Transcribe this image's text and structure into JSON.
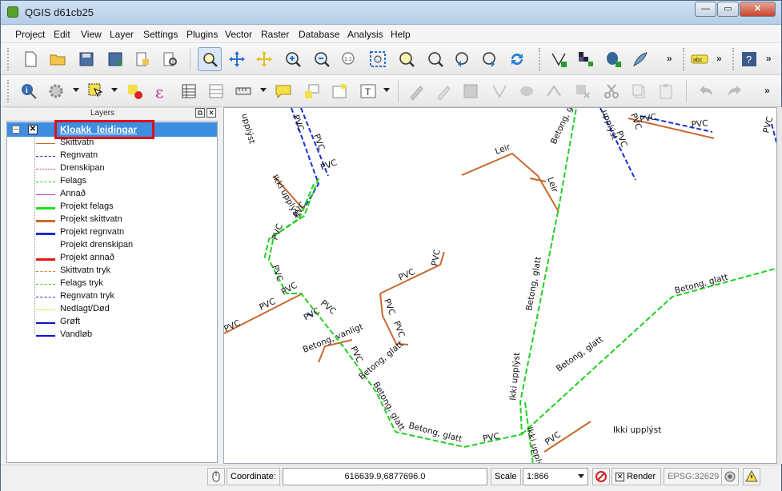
{
  "window": {
    "title": "QGIS d61cb25"
  },
  "menu": [
    "Project",
    "Edit",
    "View",
    "Layer",
    "Settings",
    "Plugins",
    "Vector",
    "Raster",
    "Database",
    "Analysis",
    "Help"
  ],
  "panel": {
    "title": "Layers"
  },
  "layer_group": {
    "name": "Kloakk_leidingar",
    "checked": true
  },
  "legend": [
    {
      "label": "Skittvatn",
      "color": "#c8692f",
      "style": "solid",
      "width": 1.5
    },
    {
      "label": "Regnvatn",
      "color": "#1a2fd0",
      "style": "dashed",
      "width": 1.5
    },
    {
      "label": "Drenskipan",
      "color": "#c8302f",
      "style": "dotted",
      "width": 1
    },
    {
      "label": "Felags",
      "color": "#22d022",
      "style": "dashed",
      "width": 1.5
    },
    {
      "label": "Annað",
      "color": "#c040c0",
      "style": "solid",
      "width": 1
    },
    {
      "label": "Projekt felags",
      "color": "#22e022",
      "style": "solid",
      "width": 3
    },
    {
      "label": "Projekt skittvatn",
      "color": "#c8692f",
      "style": "solid",
      "width": 3
    },
    {
      "label": "Projekt regnvatn",
      "color": "#1a2fd0",
      "style": "solid",
      "width": 3
    },
    {
      "label": "Projekt drenskipan",
      "color": "#ffffff",
      "style": "solid",
      "width": 1
    },
    {
      "label": "Projekt annað",
      "color": "#e01a1a",
      "style": "solid",
      "width": 3
    },
    {
      "label": "Skittvatn tryk",
      "color": "#e08030",
      "style": "dashed",
      "width": 1.5
    },
    {
      "label": "Felags tryk",
      "color": "#50d020",
      "style": "dashed",
      "width": 1.5
    },
    {
      "label": "Regnvatn tryk",
      "color": "#1a2fd0",
      "style": "dashdot",
      "width": 1.5
    },
    {
      "label": "Nedlagt/Død",
      "color": "#e8e060",
      "style": "solid",
      "width": 1
    },
    {
      "label": "Grøft",
      "color": "#1010c0",
      "style": "solid",
      "width": 2
    },
    {
      "label": "Vandløb",
      "color": "#1010e0",
      "style": "solid",
      "width": 2
    }
  ],
  "map_labels": [
    {
      "text": "upplýst"
    },
    {
      "text": "PVC"
    },
    {
      "text": "Betong, glatt"
    },
    {
      "text": "Leir"
    },
    {
      "text": "Ikki upplýst"
    },
    {
      "text": "Betong, vanligt"
    },
    {
      "text": "Betong, glatt"
    }
  ],
  "status": {
    "coordinate_label": "Coordinate:",
    "coordinate_value": "616639.9,6877696.0",
    "scale_label": "Scale",
    "scale_value": "1:866",
    "render_label": "Render",
    "render_checked": true,
    "crs": "EPSG:32629"
  },
  "colors": {
    "selection": "#3d8ee0",
    "highlight": "#e0101a",
    "sewer": "#c8692f",
    "shared": "#22d022",
    "rain": "#1a2fd0"
  }
}
